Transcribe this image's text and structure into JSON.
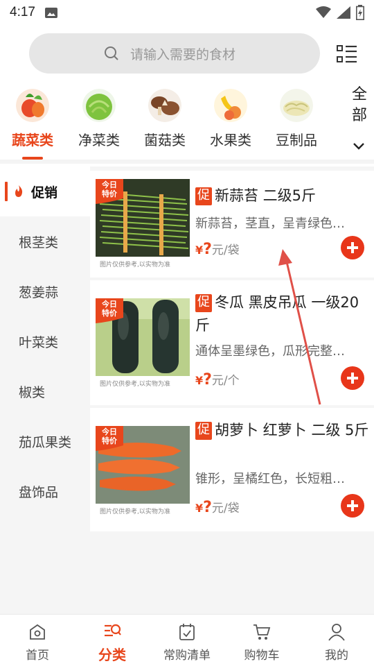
{
  "status_bar": {
    "time": "4:17"
  },
  "search": {
    "placeholder": "请输入需要的食材"
  },
  "categories": [
    {
      "label": "蔬菜类",
      "active": true
    },
    {
      "label": "净菜类",
      "active": false
    },
    {
      "label": "菌菇类",
      "active": false
    },
    {
      "label": "水果类",
      "active": false
    },
    {
      "label": "豆制品",
      "active": false
    }
  ],
  "category_all": {
    "line1": "全",
    "line2": "部"
  },
  "sidebar": [
    {
      "label": "促销",
      "active": true
    },
    {
      "label": "根茎类",
      "active": false
    },
    {
      "label": "葱姜蒜",
      "active": false
    },
    {
      "label": "叶菜类",
      "active": false
    },
    {
      "label": "椒类",
      "active": false
    },
    {
      "label": "茄瓜果类",
      "active": false
    },
    {
      "label": "盘饰品",
      "active": false
    }
  ],
  "products": [
    {
      "promo_tag": "促",
      "title": "新蒜苔 二级5斤",
      "desc": "新蒜苔，茎直，呈青绿色…",
      "price_symbol": "¥",
      "price_value": "?",
      "unit": "元/袋",
      "badge_line1": "今日",
      "badge_line2": "特价",
      "caption": "图片仅供参考,以实物为准"
    },
    {
      "promo_tag": "促",
      "title": "冬瓜 黑皮吊瓜 一级20斤",
      "desc": "通体呈墨绿色，瓜形完整…",
      "price_symbol": "¥",
      "price_value": "?",
      "unit": "元/个",
      "badge_line1": "今日",
      "badge_line2": "特价",
      "caption": "图片仅供参考,以实物为准"
    },
    {
      "promo_tag": "促",
      "title": "胡萝卜 红萝卜 二级 5斤",
      "desc": "锥形，呈橘红色，长短粗…",
      "price_symbol": "¥",
      "price_value": "?",
      "unit": "元/袋",
      "badge_line1": "今日",
      "badge_line2": "特价",
      "caption": "图片仅供参考,以实物为准"
    }
  ],
  "bottom_nav": [
    {
      "label": "首页",
      "icon": "home-icon",
      "active": false
    },
    {
      "label": "分类",
      "icon": "category-search-icon",
      "active": true
    },
    {
      "label": "常购清单",
      "icon": "checklist-icon",
      "active": false
    },
    {
      "label": "购物车",
      "icon": "cart-icon",
      "active": false
    },
    {
      "label": "我的",
      "icon": "profile-icon",
      "active": false
    }
  ],
  "colors": {
    "accent": "#e8461c",
    "sidebar_bg": "#f5f5f5",
    "search_bg": "#e6e6e6"
  }
}
